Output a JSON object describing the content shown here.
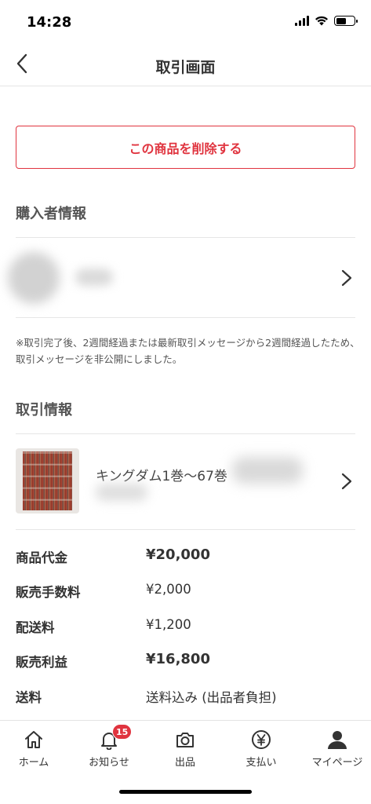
{
  "status_bar": {
    "time": "14:28"
  },
  "nav": {
    "title": "取引画面"
  },
  "actions": {
    "delete_label": "この商品を削除する"
  },
  "buyer_section": {
    "title": "購入者情報"
  },
  "notice": "※取引完了後、2週間経過または最新取引メッセージから2週間経過したため、取引メッセージを非公開にしました。",
  "transaction_section": {
    "title": "取引情報",
    "product_name": "キングダム1巻〜67巻"
  },
  "price_rows": [
    {
      "label": "商品代金",
      "value": "¥20,000",
      "emphasis": true
    },
    {
      "label": "販売手数料",
      "value": "¥2,000",
      "emphasis": false
    },
    {
      "label": "配送料",
      "value": "¥1,200",
      "emphasis": false
    },
    {
      "label": "販売利益",
      "value": "¥16,800",
      "emphasis": true
    },
    {
      "label": "送料",
      "value": "送料込み (出品者負担)",
      "emphasis": false
    }
  ],
  "tab_bar": {
    "items": [
      {
        "label": "ホーム",
        "icon": "home-icon"
      },
      {
        "label": "お知らせ",
        "icon": "bell-icon",
        "badge": "15"
      },
      {
        "label": "出品",
        "icon": "camera-icon"
      },
      {
        "label": "支払い",
        "icon": "yen-icon"
      },
      {
        "label": "マイページ",
        "icon": "person-icon"
      }
    ]
  },
  "colors": {
    "accent": "#e0343f",
    "text": "#333333",
    "divider": "#e6e6e6"
  }
}
